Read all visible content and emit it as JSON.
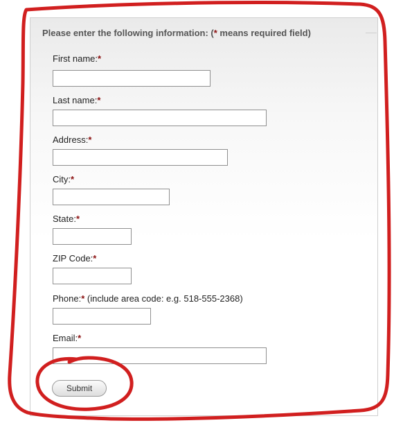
{
  "form": {
    "legend_prefix": "Please enter the following information: (",
    "legend_star": "*",
    "legend_suffix": " means required field)",
    "required_marker": "*",
    "fields": [
      {
        "label": "First name:",
        "value": "",
        "note": ""
      },
      {
        "label": "Last name:",
        "value": "",
        "note": ""
      },
      {
        "label": "Address:",
        "value": "",
        "note": ""
      },
      {
        "label": "City:",
        "value": "",
        "note": ""
      },
      {
        "label": "State:",
        "value": "",
        "note": ""
      },
      {
        "label": "ZIP Code:",
        "value": "",
        "note": ""
      },
      {
        "label": "Phone:",
        "value": "",
        "note": " (include area code: e.g. 518-555-2368)"
      },
      {
        "label": "Email:",
        "value": "",
        "note": ""
      }
    ],
    "submit_label": "Submit"
  },
  "colors": {
    "required_star": "#8b1111",
    "annotation": "#d11f1f",
    "panel_border": "#cfcfcf"
  }
}
